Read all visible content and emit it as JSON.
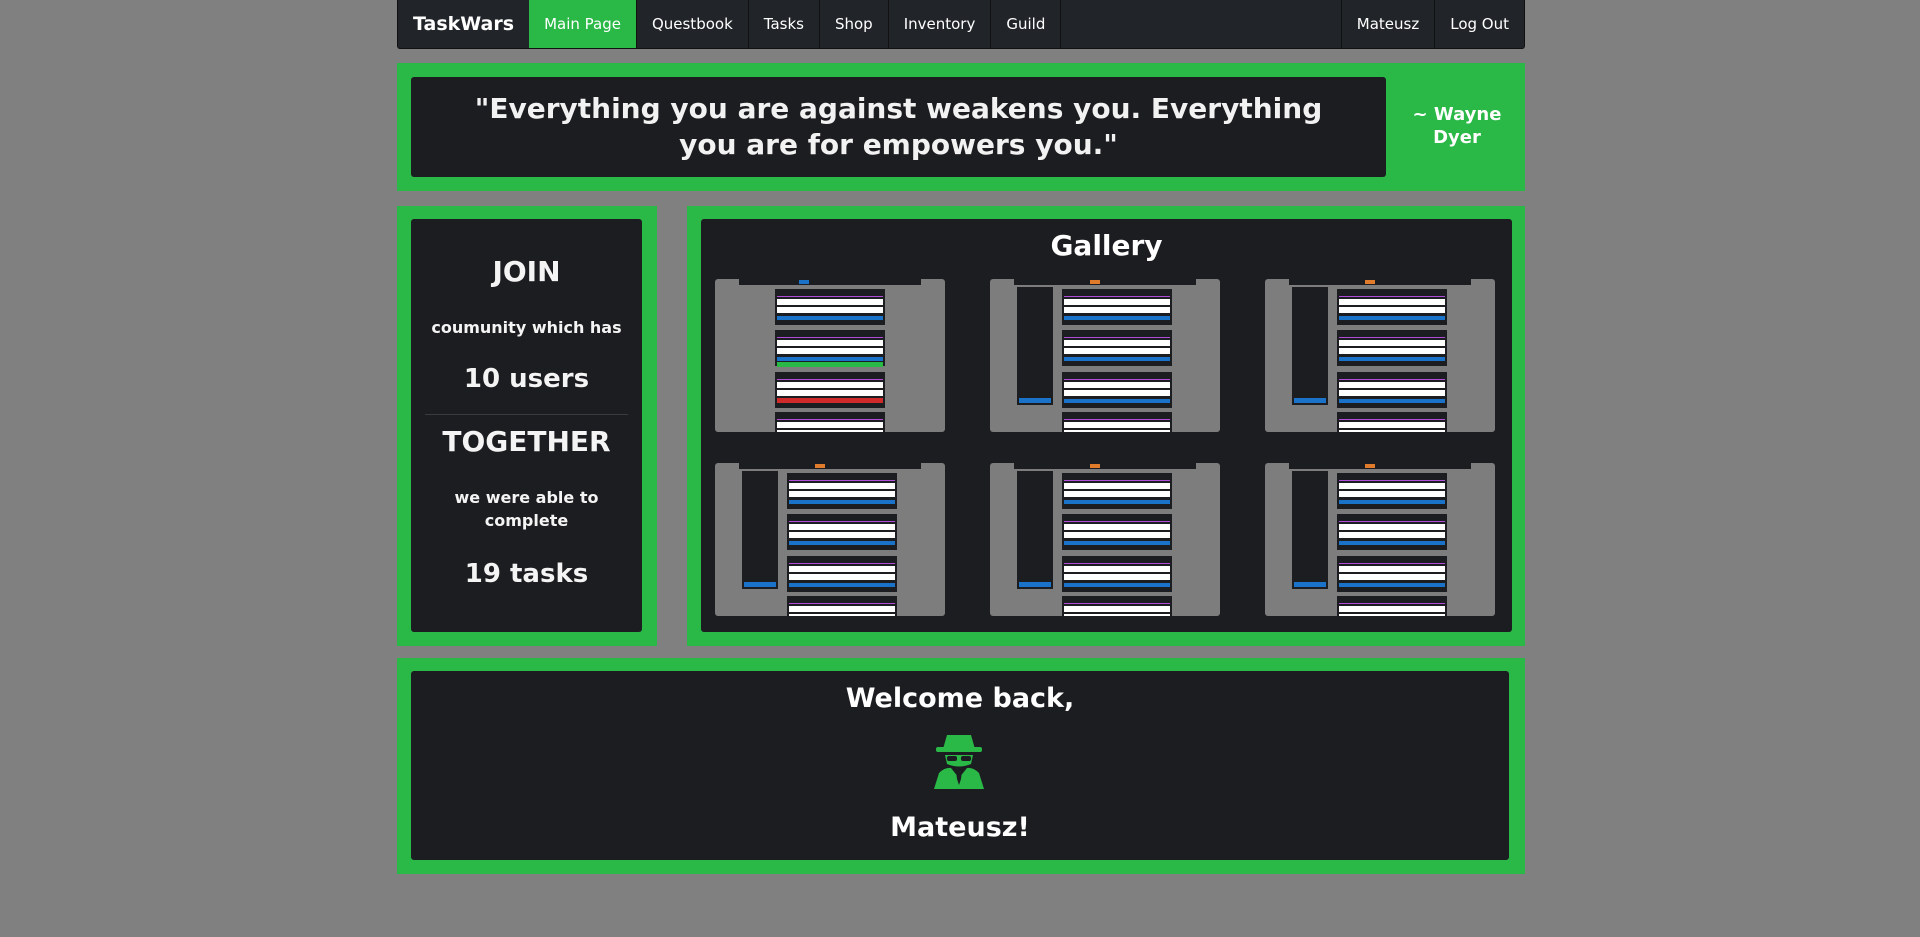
{
  "navbar": {
    "brand": "TaskWars",
    "items": [
      {
        "label": "Main Page",
        "active": true
      },
      {
        "label": "Questbook"
      },
      {
        "label": "Tasks"
      },
      {
        "label": "Shop"
      },
      {
        "label": "Inventory"
      },
      {
        "label": "Guild"
      }
    ],
    "right_items": [
      {
        "label": "Mateusz"
      },
      {
        "label": "Log Out"
      }
    ]
  },
  "quote": {
    "text": "\"Everything you are against weakens you. Everything you are for empowers you.\"",
    "author": "~ Wayne Dyer"
  },
  "stats": {
    "join": "JOIN",
    "community_text": "coumunity which has",
    "users": "10 users",
    "together": "TOGETHER",
    "complete_text": "we were able to complete",
    "tasks": "19 tasks"
  },
  "gallery": {
    "title": "Gallery",
    "image_count": 6
  },
  "welcome": {
    "greeting": "Welcome back,",
    "icon": "user-secret-icon",
    "username": "Mateusz!"
  },
  "colors": {
    "accent": "#2ab847",
    "panel": "#1c1d20",
    "background": "#808080"
  }
}
